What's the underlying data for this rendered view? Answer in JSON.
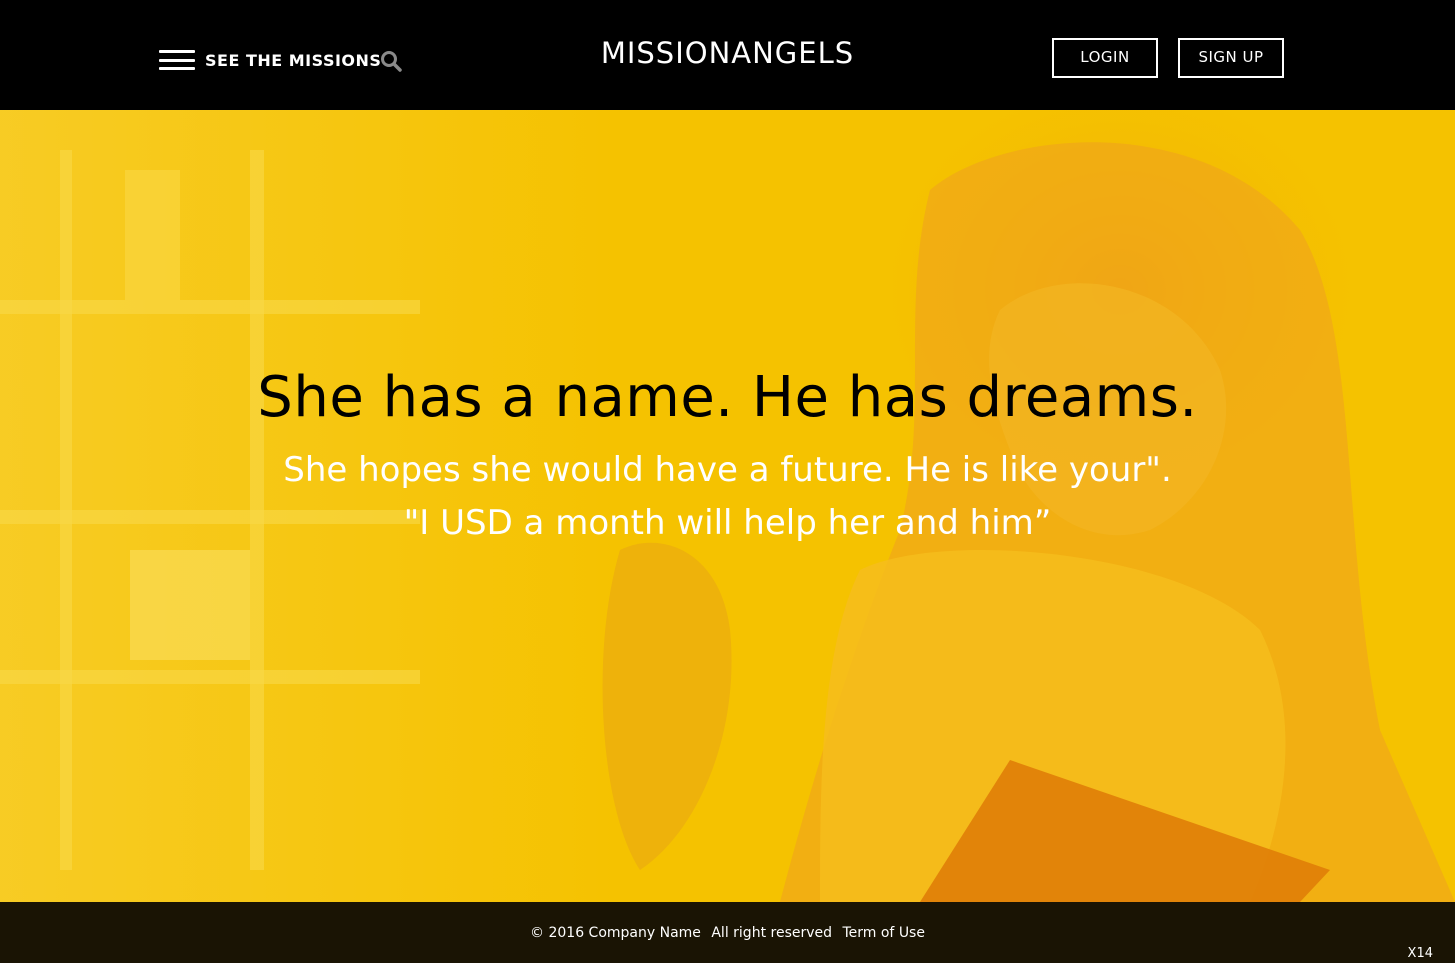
{
  "header": {
    "menu_label": "SEE THE MISSIONS",
    "brand": "MISSIONANGELS",
    "login_label": "LOGIN",
    "signup_label": "SIGN UP"
  },
  "hero": {
    "headline": "She has a name. He has dreams.",
    "subline_1": "She hopes she would have a future. He is like your\".",
    "subline_2": "\"I USD a month will help her and him”",
    "overlay_color": "#f5c200"
  },
  "footer": {
    "copyright": "© 2016 Company Name",
    "rights": "All right reserved",
    "terms": "Term of Use",
    "corner_tag": "X14"
  },
  "icons": {
    "menu": "hamburger-icon",
    "search": "search-icon"
  }
}
